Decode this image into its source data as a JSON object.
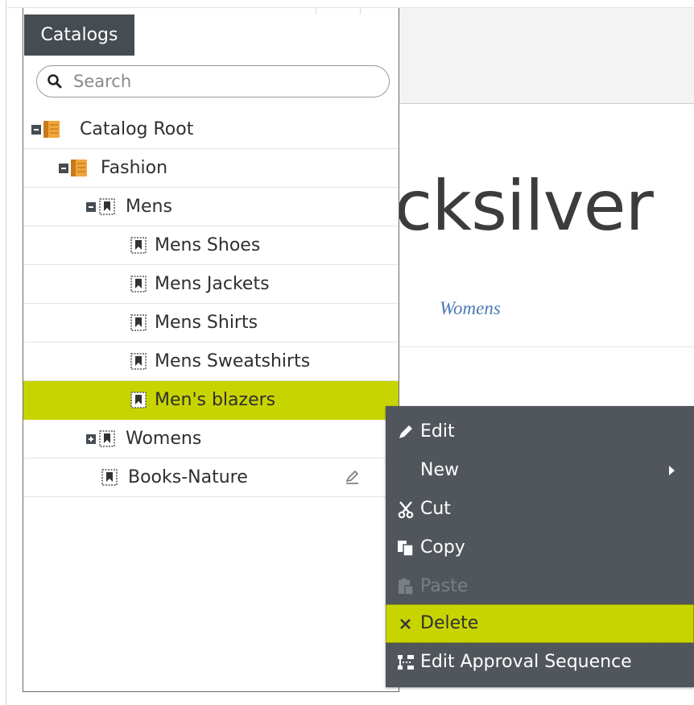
{
  "panel": {
    "tab_label": "Catalogs",
    "search_placeholder": "Search"
  },
  "tree": [
    {
      "label": "Catalog Root",
      "toggle": "collapse",
      "icon": "catalog-book-icon",
      "level": 0
    },
    {
      "label": "Fashion",
      "toggle": "collapse",
      "icon": "catalog-book-icon",
      "level": 1
    },
    {
      "label": "Mens",
      "toggle": "collapse",
      "icon": "node-icon",
      "level": 2
    },
    {
      "label": "Mens Shoes",
      "icon": "node-icon",
      "level": 3
    },
    {
      "label": "Mens Jackets",
      "icon": "node-icon",
      "level": 3
    },
    {
      "label": "Mens Shirts",
      "icon": "node-icon",
      "level": 3
    },
    {
      "label": "Mens Sweatshirts",
      "icon": "node-icon",
      "level": 3
    },
    {
      "label": "Men's blazers",
      "icon": "node-icon",
      "level": 3,
      "selected": true
    },
    {
      "label": "Womens",
      "toggle": "expand",
      "icon": "node-icon",
      "level": 2
    },
    {
      "label": "Books-Nature",
      "icon": "node-icon",
      "level": 2,
      "has_edit_icon": true
    }
  ],
  "content": {
    "brand_text": "cksilver",
    "nav_link": "Womens"
  },
  "context_menu": {
    "items": [
      {
        "label": "Edit",
        "icon": "pencil-icon"
      },
      {
        "label": "New",
        "icon": "",
        "submenu": true
      },
      {
        "label": "Cut",
        "icon": "scissors-icon"
      },
      {
        "label": "Copy",
        "icon": "copy-icon"
      },
      {
        "label": "Paste",
        "icon": "paste-icon",
        "disabled": true
      },
      {
        "label": "Delete",
        "icon": "delete-x-icon",
        "highlighted": true
      },
      {
        "label": "Edit Approval Sequence",
        "icon": "approval-sequence-icon"
      }
    ]
  },
  "colors": {
    "accent": "#c8d400",
    "menu_bg": "#50565c",
    "tab_bg": "#454c52",
    "link": "#4a7ab3"
  }
}
